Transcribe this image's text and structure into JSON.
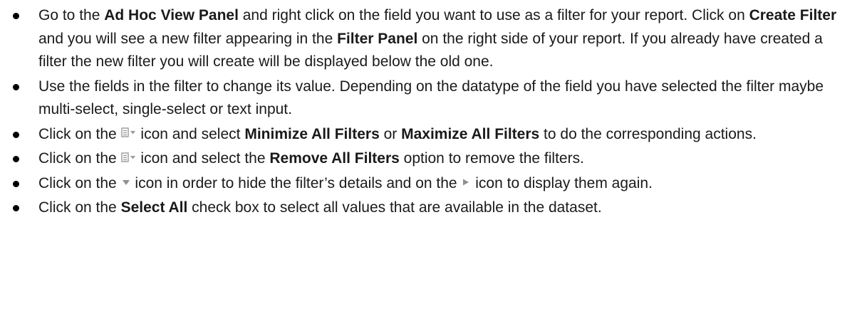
{
  "icons": {
    "panel_menu": "panel-menu-icon",
    "collapse": "triangle-down-icon",
    "expand": "triangle-right-icon",
    "icon_color": "#9a9a9a"
  },
  "bullets": [
    {
      "p1": "Go to the ",
      "b1": "Ad Hoc View Panel",
      "p2": " and right click on the field you want to use as a filter for your report. Click on ",
      "b2": "Create Filter",
      "p3": " and you will see a new filter appearing in the ",
      "b3": "Filter Panel",
      "p4": " on the right side of your report. If you already have created a filter the new filter you will create will be displayed below the old one."
    },
    {
      "p1": "Use the fields in the filter to change its value. Depending on the datatype of the field you have selected the filter maybe multi-select, single-select or text input."
    },
    {
      "p1": "Click on the ",
      "p2": " icon and select ",
      "b1": "Minimize All Filters",
      "p3": " or ",
      "b2": "Maximize All Filters",
      "p4": " to do the corresponding actions."
    },
    {
      "p1": "Click on the ",
      "p2": " icon and select the ",
      "b1": "Remove All Filters",
      "p3": " option to remove the filters."
    },
    {
      "p1": "Click on the ",
      "p2": " icon in order to hide the filter’s details and on the ",
      "p3": " icon to display them again."
    },
    {
      "p1": "Click on the ",
      "b1": "Select All",
      "p2": " check box to select all values that are available in the dataset."
    }
  ]
}
